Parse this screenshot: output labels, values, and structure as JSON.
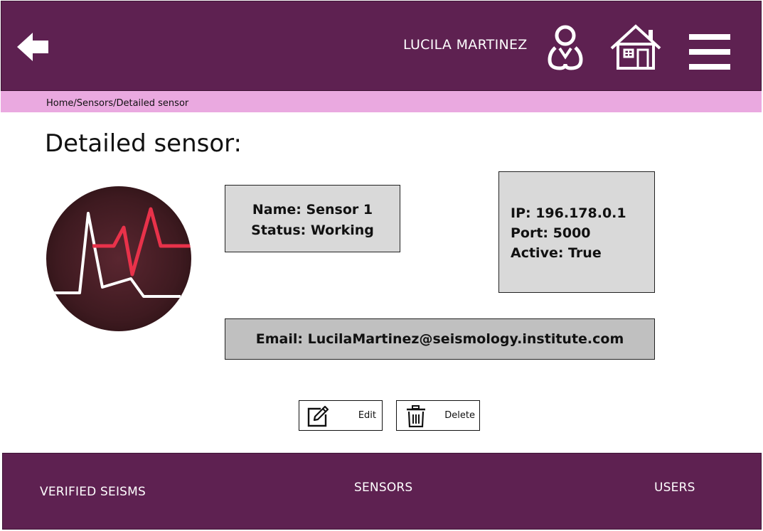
{
  "header": {
    "user_name": "LUCILA MARTINEZ",
    "icons": [
      "back-arrow-icon",
      "user-icon",
      "home-icon",
      "menu-icon"
    ]
  },
  "breadcrumb": "Home/Sensors/Detailed sensor",
  "page_title": "Detailed sensor:",
  "sensor": {
    "avatar_icon": "seismograph-icon",
    "name_line": "Name: Sensor 1",
    "status_line": "Status: Working",
    "ip_line": "IP: 196.178.0.1",
    "port_line": "Port: 5000",
    "active_line": "Active: True",
    "email_line": "Email: LucilaMartinez@seismology.institute.com"
  },
  "actions": {
    "edit_label": "Edit",
    "delete_label": "Delete"
  },
  "footer": {
    "verified_seisms": "VERIFIED SEISMS",
    "sensors": "SENSORS",
    "users": "USERS"
  },
  "colors": {
    "header_bg": "#5e2151",
    "breadcrumb_bg": "#eaa9e0",
    "box_bg": "#d9d9d9",
    "email_box_bg": "#c0c0c0",
    "signal_red": "#e8324a"
  }
}
